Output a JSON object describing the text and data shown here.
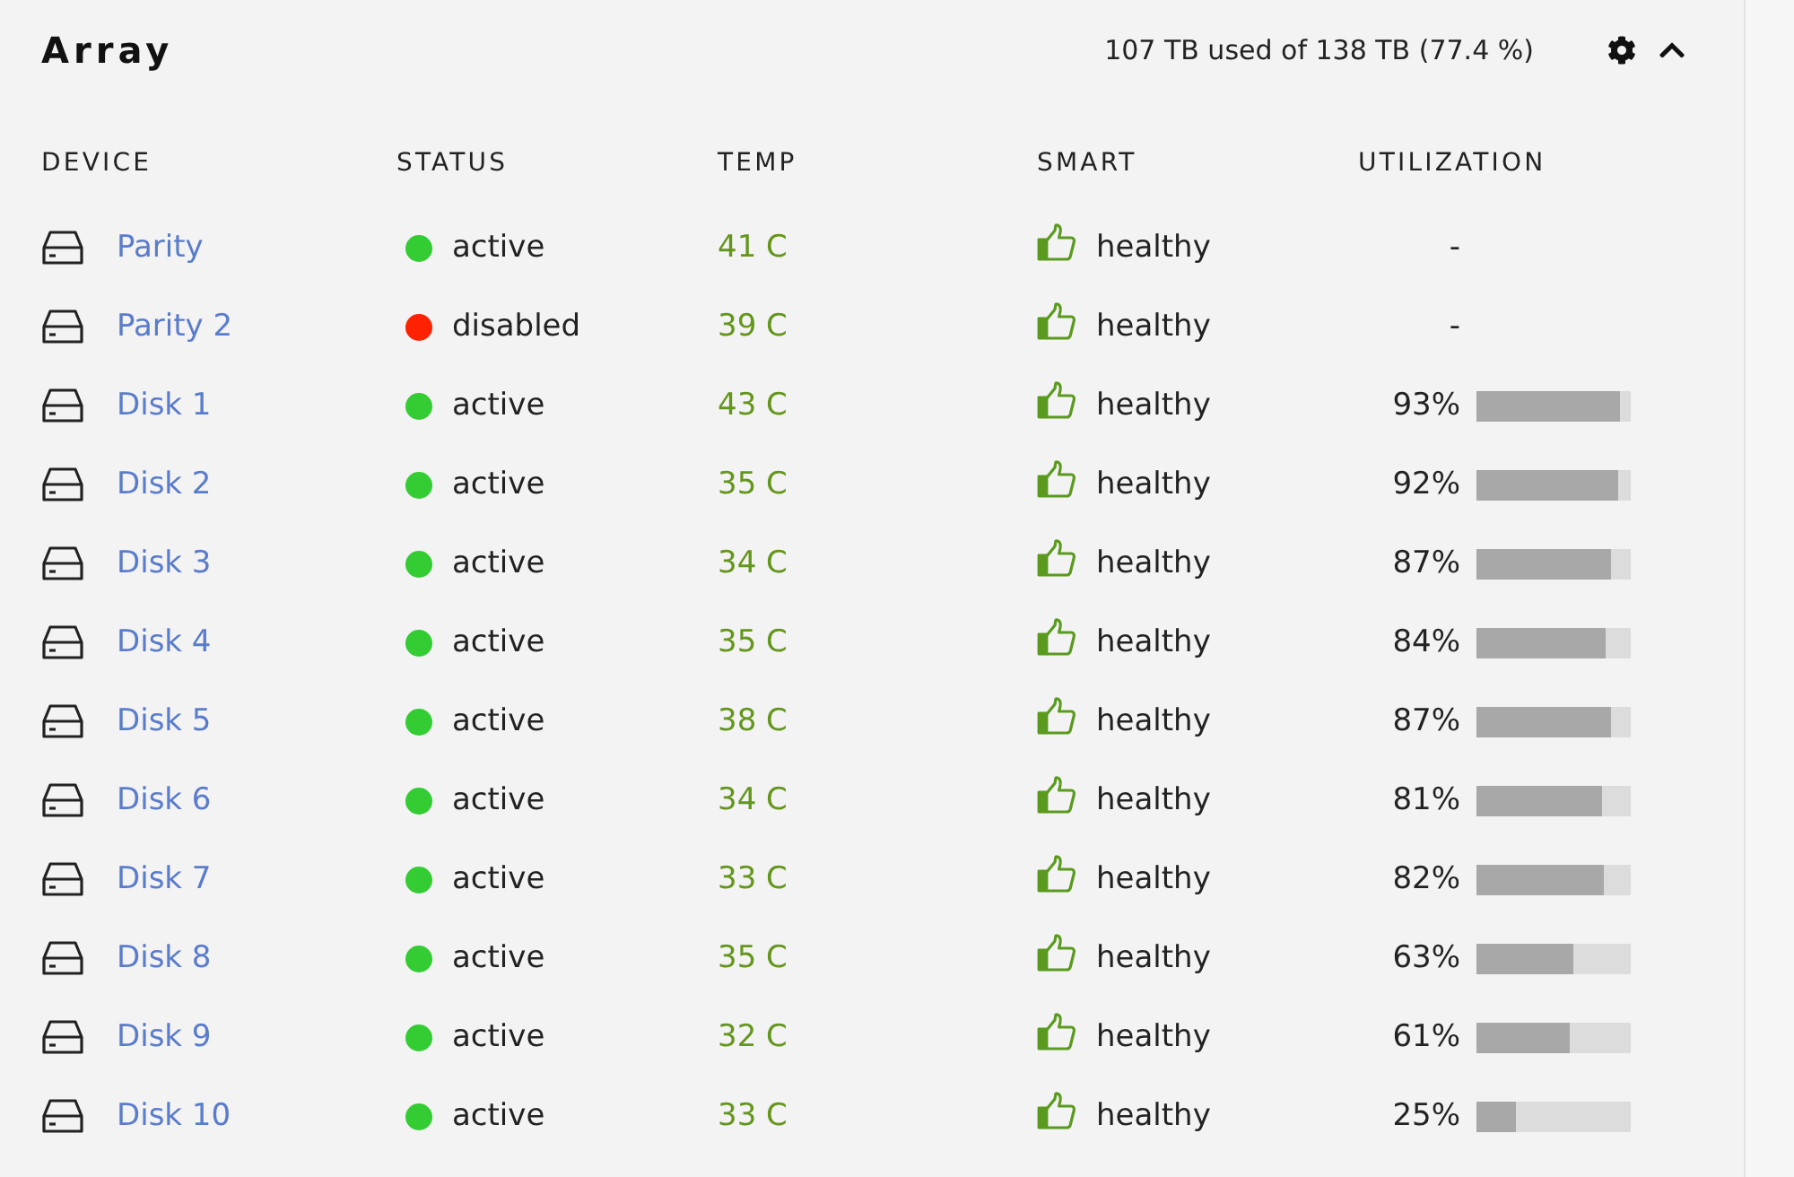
{
  "panel": {
    "title": "Array",
    "usage": "107 TB used of 138 TB (77.4 %)",
    "expanded": true
  },
  "columns": [
    "DEVICE",
    "STATUS",
    "TEMP",
    "SMART",
    "UTILIZATION"
  ],
  "devices": [
    {
      "name": "Parity",
      "status": {
        "text": "active",
        "color": "#33cc33"
      },
      "temp": "41 C",
      "smart": "healthy",
      "utilization": {
        "text": "-"
      }
    },
    {
      "name": "Parity 2",
      "status": {
        "text": "disabled",
        "color": "#ff2200"
      },
      "temp": "39 C",
      "smart": "healthy",
      "utilization": {
        "text": "-"
      }
    },
    {
      "name": "Disk 1",
      "status": {
        "text": "active",
        "color": "#33cc33"
      },
      "temp": "43 C",
      "smart": "healthy",
      "utilization": {
        "text": "93%",
        "level": 0.93
      }
    },
    {
      "name": "Disk 2",
      "status": {
        "text": "active",
        "color": "#33cc33"
      },
      "temp": "35 C",
      "smart": "healthy",
      "utilization": {
        "text": "92%",
        "level": 0.92
      }
    },
    {
      "name": "Disk 3",
      "status": {
        "text": "active",
        "color": "#33cc33"
      },
      "temp": "34 C",
      "smart": "healthy",
      "utilization": {
        "text": "87%",
        "level": 0.87
      }
    },
    {
      "name": "Disk 4",
      "status": {
        "text": "active",
        "color": "#33cc33"
      },
      "temp": "35 C",
      "smart": "healthy",
      "utilization": {
        "text": "84%",
        "level": 0.84
      }
    },
    {
      "name": "Disk 5",
      "status": {
        "text": "active",
        "color": "#33cc33"
      },
      "temp": "38 C",
      "smart": "healthy",
      "utilization": {
        "text": "87%",
        "level": 0.87
      }
    },
    {
      "name": "Disk 6",
      "status": {
        "text": "active",
        "color": "#33cc33"
      },
      "temp": "34 C",
      "smart": "healthy",
      "utilization": {
        "text": "81%",
        "level": 0.81
      }
    },
    {
      "name": "Disk 7",
      "status": {
        "text": "active",
        "color": "#33cc33"
      },
      "temp": "33 C",
      "smart": "healthy",
      "utilization": {
        "text": "82%",
        "level": 0.82
      }
    },
    {
      "name": "Disk 8",
      "status": {
        "text": "active",
        "color": "#33cc33"
      },
      "temp": "35 C",
      "smart": "healthy",
      "utilization": {
        "text": "63%",
        "level": 0.63
      }
    },
    {
      "name": "Disk 9",
      "status": {
        "text": "active",
        "color": "#33cc33"
      },
      "temp": "32 C",
      "smart": "healthy",
      "utilization": {
        "text": "61%",
        "level": 0.61
      }
    },
    {
      "name": "Disk 10",
      "status": {
        "text": "active",
        "color": "#33cc33"
      },
      "temp": "33 C",
      "smart": "healthy",
      "utilization": {
        "text": "25%",
        "level": 0.25
      }
    }
  ]
}
